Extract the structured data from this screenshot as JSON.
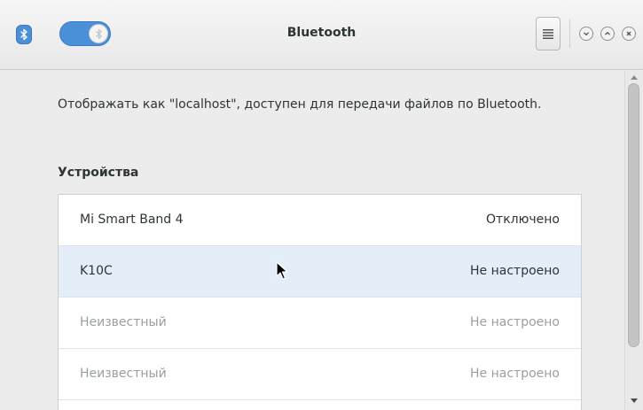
{
  "window": {
    "title": "Bluetooth",
    "app_icon": "bluetooth-icon",
    "toggle_state": "on",
    "menu_icon": "hamburger-menu-icon",
    "controls": [
      "minimize-icon",
      "maximize-icon",
      "close-icon"
    ]
  },
  "content": {
    "description": "Отображать как \"localhost\", доступен для передачи файлов по Bluetooth.",
    "section_title": "Устройства",
    "devices": [
      {
        "name": "Mi Smart Band 4",
        "status": "Отключено"
      },
      {
        "name": "K10C",
        "status": "Не настроено"
      },
      {
        "name": "Неизвестный",
        "status": "Не настроено"
      },
      {
        "name": "Неизвестный",
        "status": "Не настроено"
      }
    ]
  },
  "colors": {
    "accent": "#4a90d9",
    "selected_row": "#e3eef9",
    "dim_text": "#9aa0a1"
  }
}
